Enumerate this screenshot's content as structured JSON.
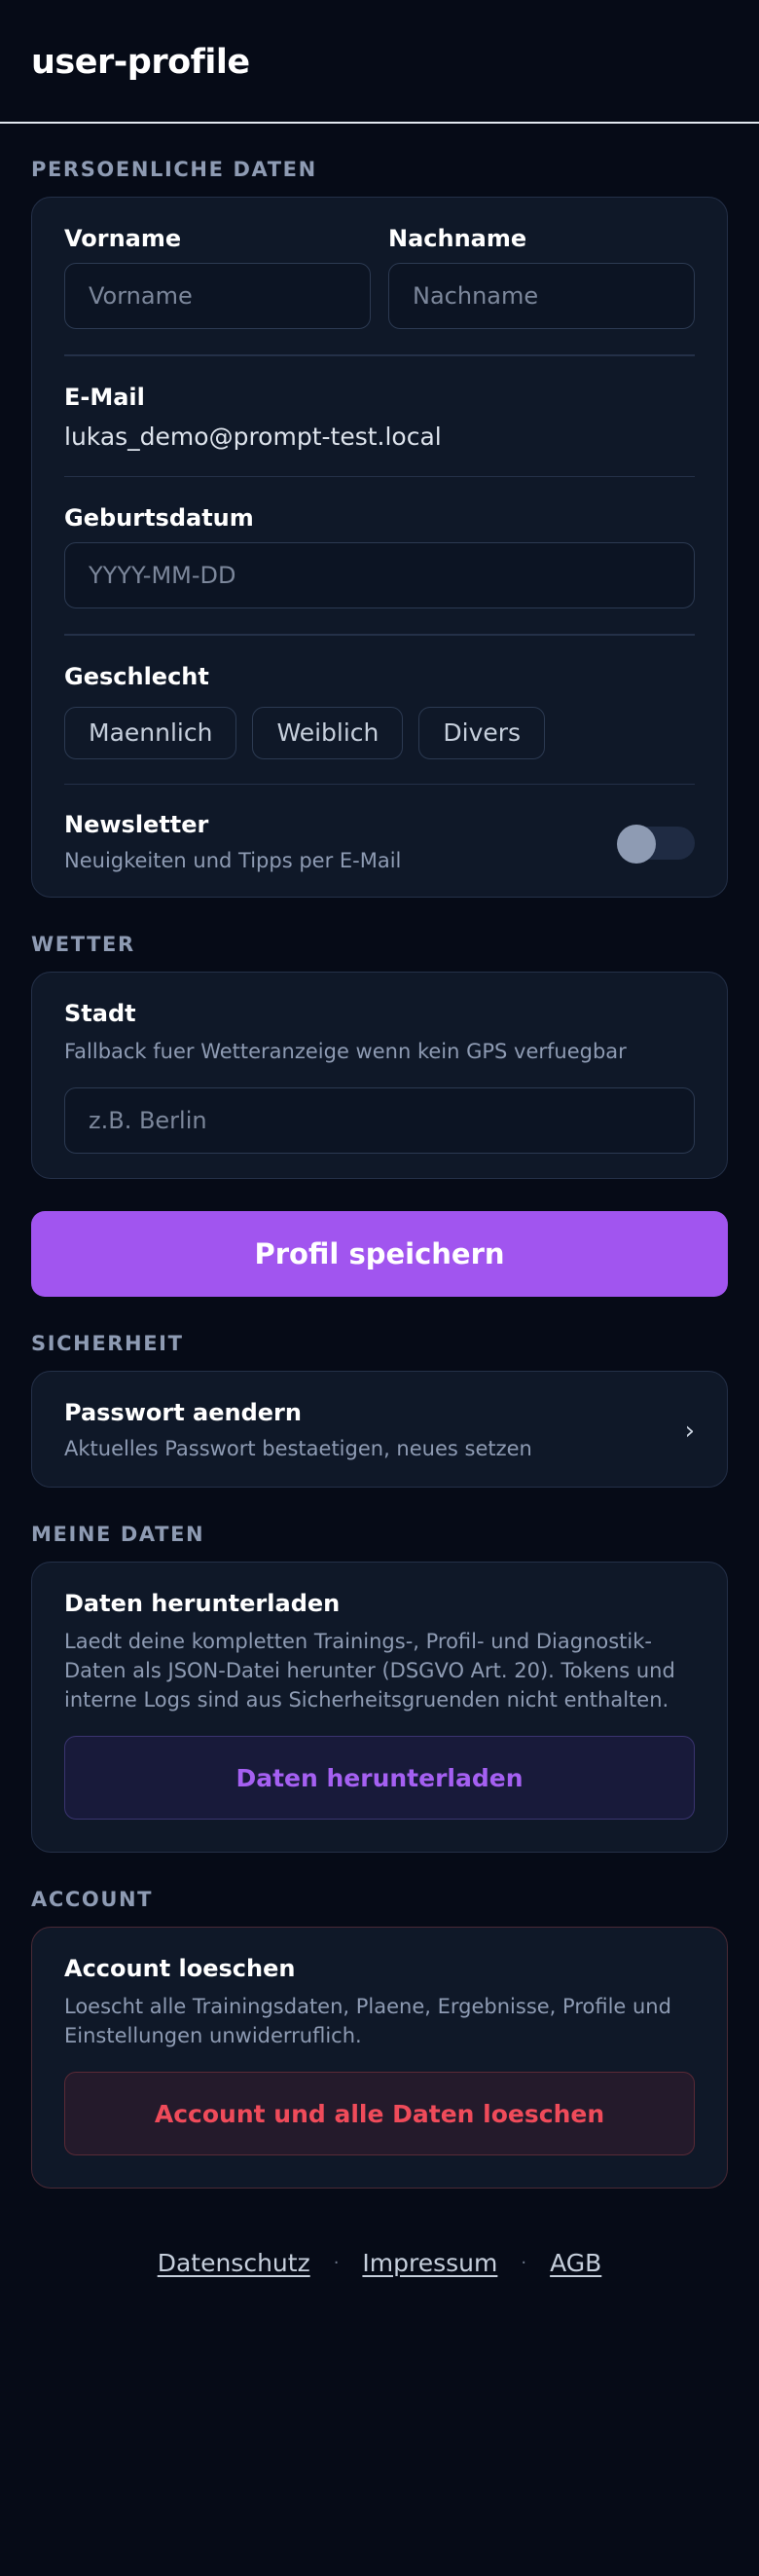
{
  "header": {
    "title": "user-profile"
  },
  "personal": {
    "section_label": "PERSOENLICHE DATEN",
    "firstname_label": "Vorname",
    "firstname_placeholder": "Vorname",
    "lastname_label": "Nachname",
    "lastname_placeholder": "Nachname",
    "email_label": "E-Mail",
    "email_value": "lukas_demo@prompt-test.local",
    "birthdate_label": "Geburtsdatum",
    "birthdate_placeholder": "YYYY-MM-DD",
    "gender_label": "Geschlecht",
    "gender_options": [
      "Maennlich",
      "Weiblich",
      "Divers"
    ],
    "newsletter_label": "Newsletter",
    "newsletter_desc": "Neuigkeiten und Tipps per E-Mail",
    "newsletter_enabled": false
  },
  "weather": {
    "section_label": "WETTER",
    "city_label": "Stadt",
    "city_desc": "Fallback fuer Wetteranzeige wenn kein GPS verfuegbar",
    "city_placeholder": "z.B. Berlin"
  },
  "save_button": "Profil speichern",
  "security": {
    "section_label": "SICHERHEIT",
    "password_title": "Passwort aendern",
    "password_desc": "Aktuelles Passwort bestaetigen, neues setzen"
  },
  "my_data": {
    "section_label": "MEINE DATEN",
    "title": "Daten herunterladen",
    "desc": "Laedt deine kompletten Trainings-, Profil- und Diagnostik-Daten als JSON-Datei herunter (DSGVO Art. 20). Tokens und interne Logs sind aus Sicherheitsgruenden nicht enthalten.",
    "button": "Daten herunterladen"
  },
  "account": {
    "section_label": "ACCOUNT",
    "title": "Account loeschen",
    "desc": "Loescht alle Trainingsdaten, Plaene, Ergebnisse, Profile und Einstellungen unwiderruflich.",
    "button": "Account und alle Daten loeschen"
  },
  "footer": {
    "links": [
      "Datenschutz",
      "Impressum",
      "AGB"
    ],
    "separator": "·"
  },
  "colors": {
    "background": "#060b17",
    "card": "#0f1828",
    "accent": "#a155ef",
    "danger": "#ef4b5a"
  }
}
